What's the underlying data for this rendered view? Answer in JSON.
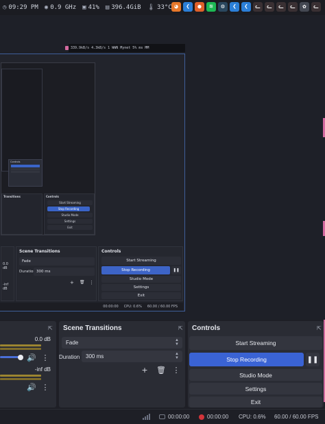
{
  "topbar": {
    "time": "09:29 PM",
    "cpu_freq": "0.9 GHz",
    "cpu_pct": "41%",
    "disk": "396.4GiB",
    "temp": "33°C"
  },
  "tray_icons": [
    "blender-icon",
    "vscode-icon",
    "firefox-icon",
    "spotify-icon",
    "steam-icon",
    "vscode-icon",
    "vscode-icon",
    "cat-icon",
    "cat-icon",
    "cat-icon",
    "cat-icon",
    "settings-icon",
    "cat-icon"
  ],
  "nested": {
    "strip_text": "339.9kB/s  4.3kB/s  1  WWN  Mynet  5%  ms  MM",
    "mid_strip_text": "339.9kB/s 4.3kB/s",
    "scene_transitions_title": "Scene Transitions",
    "controls_title": "Controls",
    "fade": "Fade",
    "duration_label": "Duration",
    "duration_value": "300 ms",
    "start_streaming": "Start Streaming",
    "stop_recording": "Stop Recording",
    "studio_mode": "Studio Mode",
    "settings": "Settings",
    "exit": "Exit",
    "db0": "0.0 dB",
    "dbinf": "-inf dB",
    "status_time": "00:00:00",
    "cpu": "CPU: 0.6%",
    "fps": "60.00 / 60.00 FPS",
    "tiny_transitions": "Transitions",
    "tiny_controls": "Controls",
    "tiny_stop": "Stop Recording",
    "tiny_studio": "Studio Mode",
    "tiny_settings": "Settings",
    "tiny_exit": "Exit",
    "tiny_start": "Start Streaming"
  },
  "audio": {
    "db_top": "0.0 dB",
    "db_bottom": "-inf dB"
  },
  "transitions": {
    "title": "Scene Transitions",
    "type": "Fade",
    "duration_label": "Duration",
    "duration_value": "300 ms"
  },
  "controls": {
    "title": "Controls",
    "start_streaming": "Start Streaming",
    "stop_recording": "Stop Recording",
    "studio_mode": "Studio Mode",
    "settings": "Settings",
    "exit": "Exit"
  },
  "status": {
    "stream_time": "00:00:00",
    "rec_time": "00:00:00",
    "cpu": "CPU: 0.6%",
    "fps": "60.00 / 60.00 FPS"
  },
  "colors": {
    "accent_blue": "#3a63d4",
    "record_red": "#d3343a",
    "pink": "#d46aa0"
  }
}
